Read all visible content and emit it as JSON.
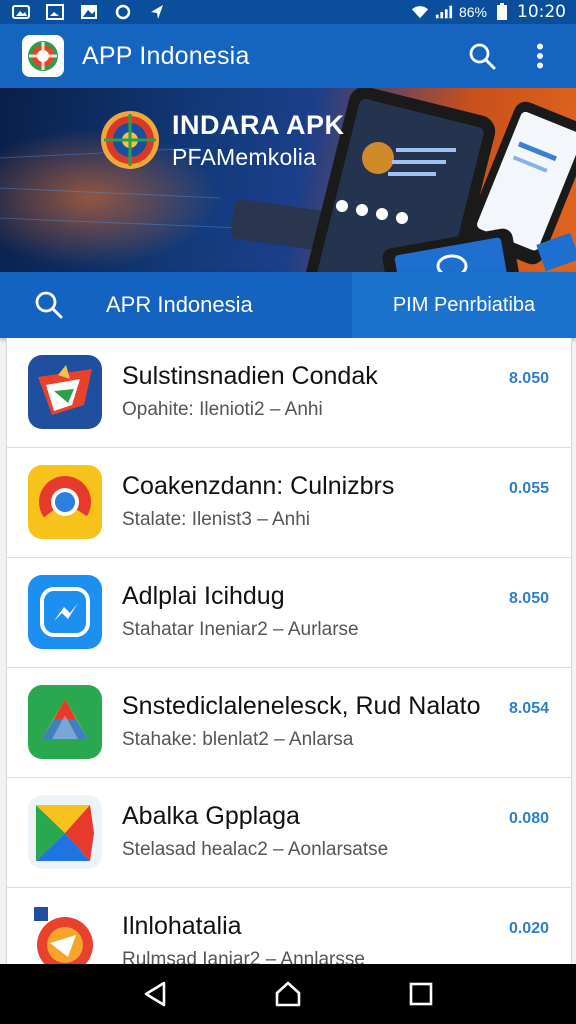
{
  "status_bar": {
    "battery_text": "86%",
    "time": "10:20",
    "icons_left": [
      "image-icon",
      "gallery-icon",
      "photo-icon",
      "sync-icon",
      "location-icon"
    ],
    "icons_right": [
      "wifi-icon",
      "signal-icon",
      "battery-icon"
    ]
  },
  "app_bar": {
    "title": "APP Indonesia",
    "actions": [
      "search-icon",
      "more-vert-icon"
    ]
  },
  "banner": {
    "title": "INDARA APK",
    "subtitle": "PFAMemkolia"
  },
  "tabs": {
    "left_label": "APR Indonesia",
    "right_label": "PIM Penrbiatiba"
  },
  "list": {
    "items": [
      {
        "title": "Sulstinsnadien Condak",
        "subtitle": "Opahite: Ilenioti2 – Anhi",
        "value": "8.050",
        "icon": "flag-app-icon"
      },
      {
        "title": "Coakenzdann: Culnizbrs",
        "subtitle": "Stalate: Ilenist3 – Anhi",
        "value": "0.055",
        "icon": "chrome-app-icon"
      },
      {
        "title": "Adlplai Icihdug",
        "subtitle": "Stahatar Ineniar2 – Aurlarse",
        "value": "8.050",
        "icon": "messenger-app-icon"
      },
      {
        "title": "Snstediclalenelesck, Rud Nalato",
        "subtitle": "Stahake: blenlat2 – Anlarsa",
        "value": "8.054",
        "icon": "drive-app-icon"
      },
      {
        "title": "Abalka Gpplaga",
        "subtitle": "Stelasad healac2 – Aonlarsatse",
        "value": "0.080",
        "icon": "play-app-icon"
      },
      {
        "title": "Ilnlohatalia",
        "subtitle": "Rulmsad Ianiar2 – Annlarsse",
        "value": "0.020",
        "icon": "orange-app-icon"
      }
    ]
  },
  "colors": {
    "status_bar": "#0b4f9c",
    "app_bar": "#1565c0",
    "accent_value": "#2d7fc9"
  },
  "nav_bar": {
    "buttons": [
      "back-icon",
      "home-icon",
      "recents-icon"
    ]
  }
}
